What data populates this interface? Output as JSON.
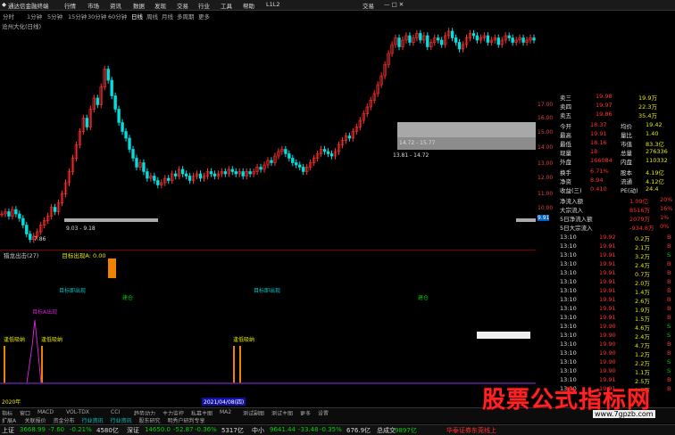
{
  "menu": {
    "app_title": "通达信金融终端",
    "items": [
      "行情",
      "市场",
      "资讯",
      "数据",
      "发现",
      "交易",
      "行业",
      "工具",
      "帮助"
    ],
    "right_label": "L1L2",
    "trade_label": "交易"
  },
  "periods": [
    "分时",
    "1分钟",
    "5分钟",
    "15分钟",
    "30分钟",
    "60分钟",
    "日线",
    "周线",
    "月线",
    "多周期",
    "更多"
  ],
  "active_period": "日线",
  "stock_title": "沧州大化(日线)",
  "price_axis": [
    "17.00",
    "16.00",
    "15.00",
    "14.00",
    "13.00",
    "12.00",
    "11.00",
    "10.00",
    "9.91"
  ],
  "ind_axis": [
    "100.00",
    "90.00",
    "80.00",
    "70.00",
    "60.00",
    "50.00",
    "40.00",
    "30.00",
    "20.00",
    "10.00"
  ],
  "chart_labels": {
    "range1": "14.72 - 15.77",
    "range2": "13.81 - 14.72",
    "range3": "9.03 - 9.18",
    "low_price": "7.86"
  },
  "quote": [
    {
      "k": "卖三",
      "v": "19.98",
      "v2": "19.9万"
    },
    {
      "k": "卖四",
      "v": "19.97",
      "v2": "22.3万"
    },
    {
      "k": "卖五",
      "v": "19.86",
      "v2": "35.4万"
    },
    {
      "k": "今开",
      "v": "18.37",
      "k2": "均价",
      "v3": "19.42"
    },
    {
      "k": "最高",
      "v": "19.91",
      "k2": "量比",
      "v3": "1.40"
    },
    {
      "k": "最低",
      "v": "18.16",
      "k2": "市值",
      "v3": "83.3亿"
    },
    {
      "k": "现量",
      "v": "18",
      "k2": "总量",
      "v3": "276336"
    },
    {
      "k": "外盘",
      "v": "166084",
      "k2": "内盘",
      "v3": "110332"
    },
    {
      "k": "换手",
      "v": "6.71%",
      "k2": "股本",
      "v3": "4.19亿"
    },
    {
      "k": "净资",
      "v": "8.94",
      "k2": "流通",
      "v3": "4.12亿"
    },
    {
      "k": "收益(三)",
      "v": "0.410",
      "k2": "PE(动)",
      "v3": "24.4"
    }
  ],
  "flows": [
    {
      "k": "净流入额",
      "v": "1.09亿",
      "p": "20%"
    },
    {
      "k": "大宗流入",
      "v": "8516万",
      "p": "16%"
    },
    {
      "k": "5日净流入额",
      "v": "2079万",
      "p": "1%"
    },
    {
      "k": "5日大宗流入",
      "v": "-934.8万",
      "p": "0%"
    }
  ],
  "ticks": [
    {
      "t": "13:10",
      "p": "19.92",
      "v": "0.2万",
      "s": "B"
    },
    {
      "t": "13:10",
      "p": "19.91",
      "v": "2.1万",
      "s": "B"
    },
    {
      "t": "13:10",
      "p": "19.91",
      "v": "3.2万",
      "s": "S"
    },
    {
      "t": "13:10",
      "p": "19.91",
      "v": "2.4万",
      "s": "B"
    },
    {
      "t": "13:10",
      "p": "19.91",
      "v": "0.7万",
      "s": "B"
    },
    {
      "t": "13:10",
      "p": "19.91",
      "v": "2.0万",
      "s": "B"
    },
    {
      "t": "13:10",
      "p": "19.91",
      "v": "1.4万",
      "s": "B"
    },
    {
      "t": "13:10",
      "p": "19.91",
      "v": "2.6万",
      "s": "B"
    },
    {
      "t": "13:10",
      "p": "19.91",
      "v": "1.9万",
      "s": "B"
    },
    {
      "t": "13:10",
      "p": "19.91",
      "v": "1.5万",
      "s": "B"
    },
    {
      "t": "13:10",
      "p": "19.90",
      "v": "4.6万",
      "s": "S"
    },
    {
      "t": "13:10",
      "p": "19.90",
      "v": "2.4万",
      "s": "S"
    },
    {
      "t": "13:10",
      "p": "19.90",
      "v": "4.7万",
      "s": "B"
    },
    {
      "t": "13:10",
      "p": "19.90",
      "v": "1.2万",
      "s": "B"
    },
    {
      "t": "13:10",
      "p": "19.90",
      "v": "2.2万",
      "s": "S"
    },
    {
      "t": "13:10",
      "p": "19.90",
      "v": "1.1万",
      "s": "S"
    },
    {
      "t": "13:10",
      "p": "19.91",
      "v": "2.5万",
      "s": "B"
    },
    {
      "t": "13:10",
      "p": "19.91",
      "v": "1.7万",
      "s": "B"
    }
  ],
  "indicator": {
    "name": "猎龙出击(27)",
    "sub": "目标出现A: 0.00",
    "labels": [
      "目标即出现",
      "目标即出现",
      "目标A出现",
      "建仓",
      "建仓",
      "逢低吸纳",
      "逢低吸纳",
      "逢低吸纳"
    ],
    "period": "(27)"
  },
  "date_bar": {
    "left": "2020年",
    "date": "2021/04/08(四)"
  },
  "ind_tabs": [
    "指标",
    "窗口",
    "MACD",
    "VOL-TDX",
    "CCI",
    "趋势动力",
    "主力监控",
    "私募主图",
    "MA2",
    "测试副图",
    "测试主图",
    "更多",
    "设置"
  ],
  "sub_tabs": [
    "扩展A",
    "关联报价",
    "资金分布",
    "行业资讯",
    "行业资讯",
    "股东研究",
    "明秀户研判专享"
  ],
  "status": [
    {
      "k": "上证",
      "v": "3668.99",
      "c": "-7.60",
      "p": "-0.21%",
      "a": "4580亿"
    },
    {
      "k": "深证",
      "v": "14650.0",
      "c": "-52.87",
      "p": "-0.36%",
      "a": "5317亿"
    },
    {
      "k": "中小",
      "v": "9641.44",
      "c": "-33.48",
      "p": "-0.35%",
      "a": "676.9亿"
    },
    {
      "k": "总成交",
      "v": "9897亿"
    }
  ],
  "status_right": "华泰证券东莞线上",
  "watermark": "股票公式指标网",
  "watermark_url": "www.7gpzb.com",
  "chart_data": {
    "type": "candlestick",
    "ylim": [
      7.5,
      17.5
    ],
    "x": [
      0,
      1,
      2,
      3,
      4,
      5,
      6,
      7,
      8,
      9,
      10,
      11,
      12,
      13,
      14,
      15,
      16,
      17,
      18,
      19,
      20,
      21,
      22,
      23,
      24,
      25,
      26,
      27,
      28,
      29,
      30,
      31,
      32,
      33,
      34,
      35,
      36,
      37,
      38,
      39,
      40,
      41,
      42,
      43,
      44,
      45,
      46,
      47,
      48,
      49,
      50,
      51,
      52,
      53,
      54,
      55,
      56,
      57,
      58,
      59,
      60,
      61,
      62,
      63,
      64,
      65,
      66,
      67,
      68,
      69,
      70,
      71,
      72,
      73,
      74,
      75,
      76,
      77,
      78,
      79,
      80,
      81,
      82,
      83,
      84,
      85,
      86,
      87,
      88,
      89,
      90,
      91,
      92,
      93,
      94,
      95,
      96,
      97,
      98,
      99,
      100,
      101,
      102,
      103,
      104,
      105,
      106,
      107,
      108,
      109,
      110,
      111,
      112,
      113,
      114,
      115,
      116,
      117,
      118,
      119,
      120,
      121,
      122,
      123,
      124,
      125,
      126,
      127,
      128,
      129,
      130,
      131,
      132,
      133,
      134,
      135,
      136,
      137,
      138,
      139,
      140,
      141,
      142,
      143,
      144,
      145,
      146,
      147,
      148,
      149
    ],
    "close": [
      9.1,
      9.2,
      9.0,
      9.3,
      9.1,
      8.9,
      8.6,
      8.2,
      7.95,
      8.1,
      8.3,
      8.6,
      8.8,
      9.0,
      9.4,
      9.2,
      9.6,
      10.0,
      10.5,
      11.0,
      11.6,
      12.2,
      12.8,
      13.4,
      13.0,
      13.8,
      14.3,
      14.0,
      14.8,
      15.6,
      15.1,
      14.4,
      13.8,
      13.2,
      12.8,
      12.5,
      12.0,
      11.6,
      11.2,
      11.4,
      11.0,
      10.7,
      10.8,
      10.6,
      10.4,
      10.5,
      10.7,
      10.6,
      10.9,
      10.8,
      11.1,
      10.9,
      10.8,
      10.6,
      10.8,
      10.9,
      10.7,
      10.8,
      11.0,
      10.9,
      10.8,
      10.9,
      11.0,
      10.9,
      11.1,
      11.0,
      10.9,
      11.0,
      10.8,
      11.0,
      10.9,
      11.0,
      11.2,
      11.1,
      11.3,
      11.5,
      11.4,
      11.7,
      11.9,
      12.0,
      11.8,
      11.6,
      11.4,
      11.3,
      11.2,
      11.0,
      11.2,
      11.4,
      11.6,
      11.8,
      12.0,
      11.9,
      11.8,
      11.7,
      11.9,
      12.2,
      12.4,
      12.6,
      12.5,
      12.8,
      13.0,
      13.3,
      13.6,
      13.9,
      14.2,
      14.5,
      14.9,
      15.3,
      15.8,
      16.3,
      16.7,
      17.0,
      16.6,
      16.9,
      17.1,
      16.8,
      17.0,
      17.2,
      16.9,
      17.1,
      16.6,
      16.8,
      17.0,
      16.9,
      16.7,
      17.1,
      17.3,
      17.0,
      16.8,
      16.5,
      16.7,
      17.0,
      17.2,
      17.1,
      16.9,
      17.0,
      17.1,
      16.8,
      16.9,
      17.0,
      16.7,
      16.9,
      17.1,
      17.0,
      16.8,
      16.9,
      17.0,
      16.8,
      16.9,
      17.0,
      16.9
    ]
  }
}
